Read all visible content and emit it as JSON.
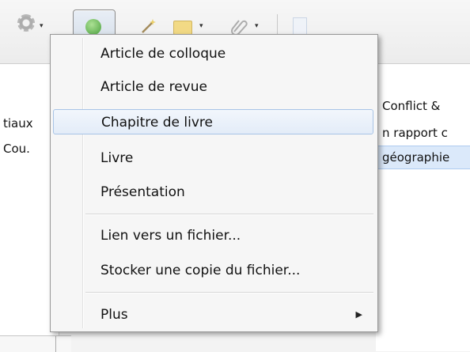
{
  "toolbar": {
    "icons": [
      "gear-icon",
      "new-item-plus-icon",
      "magic-wand-icon",
      "new-collection-folder-icon",
      "attachment-paperclip-icon",
      "new-note-icon"
    ],
    "dropdown_arrow": "▾"
  },
  "left_pane": {
    "rows": [
      "tiaux",
      "Cou."
    ]
  },
  "right_pane": {
    "rows": [
      "Conflict &",
      "n rapport c",
      "géographie"
    ]
  },
  "menu": {
    "items": [
      {
        "label": "Article de colloque"
      },
      {
        "label": "Article de revue"
      },
      {
        "label": "Chapitre de livre"
      },
      {
        "label": "Livre"
      },
      {
        "label": "Présentation"
      },
      {
        "label": "Lien vers un fichier..."
      },
      {
        "label": "Stocker une copie du fichier..."
      },
      {
        "label": "Plus"
      }
    ],
    "highlighted_item": "Chapitre de livre",
    "submenu_arrow": "▶"
  },
  "colors": {
    "menu_background": "#f6f6f6",
    "highlight": "#e3ecf8",
    "selected_row": "#dbe9fa"
  }
}
